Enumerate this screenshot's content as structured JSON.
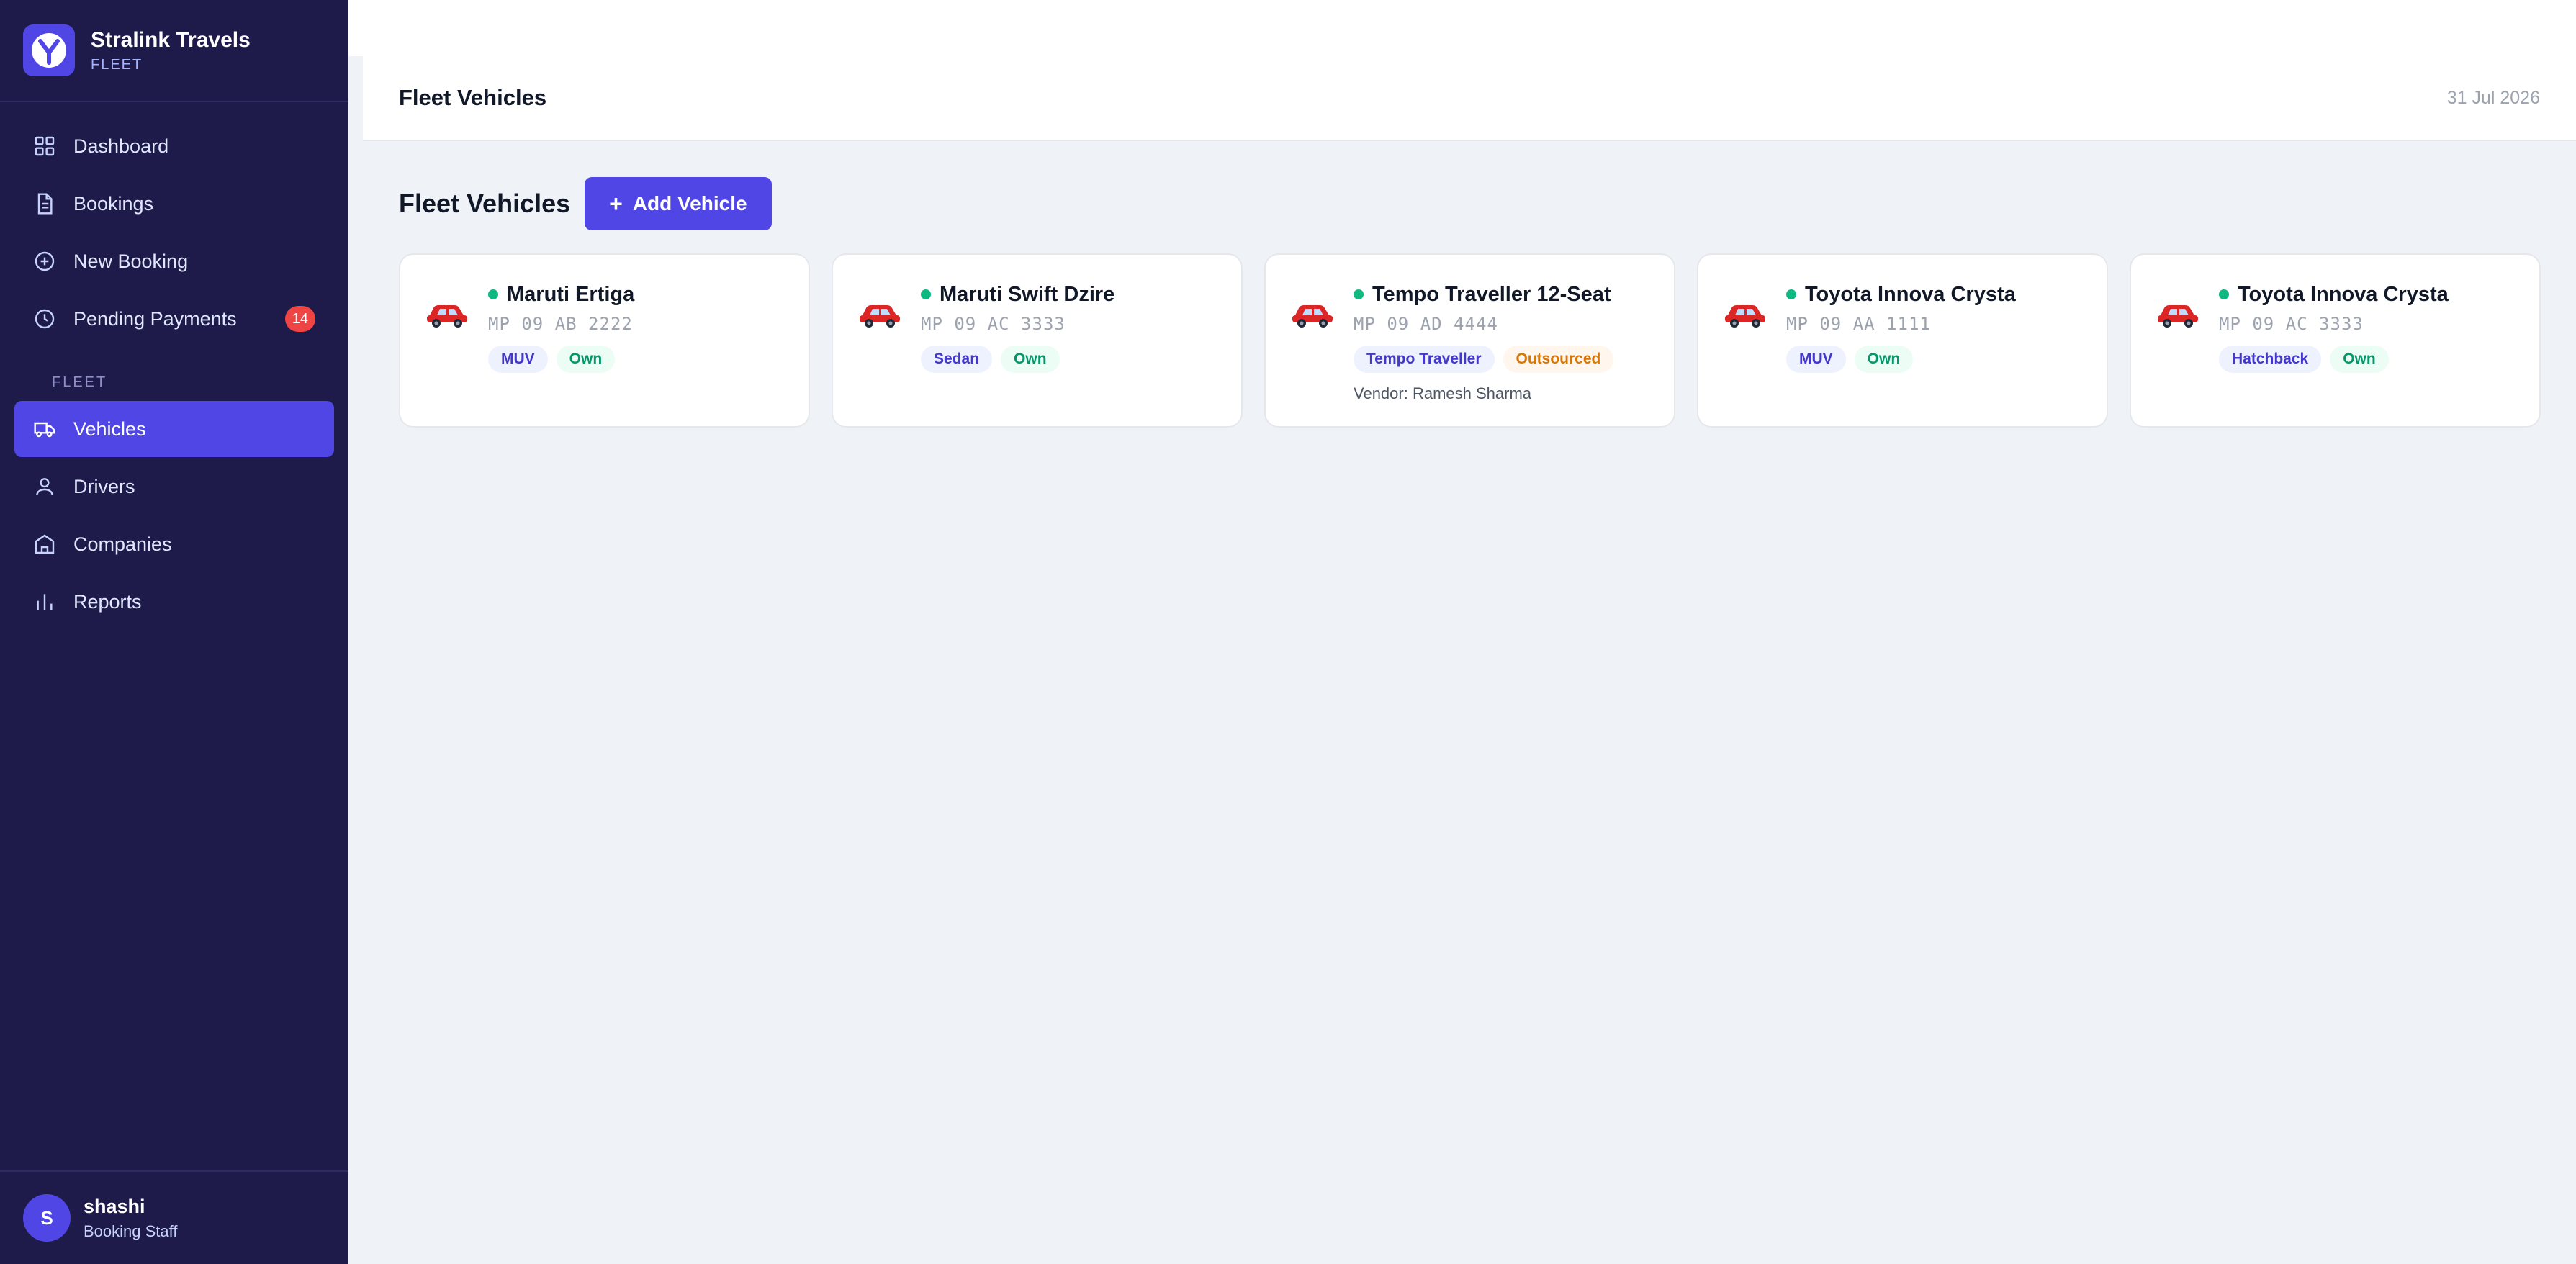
{
  "brand": {
    "name": "Stralink Travels",
    "subtitle": "FLEET",
    "logo_icon": "y-logo-icon"
  },
  "sidebar": {
    "items": [
      {
        "label": "Dashboard",
        "icon": "grid-icon"
      },
      {
        "label": "Bookings",
        "icon": "document-icon"
      },
      {
        "label": "New Booking",
        "icon": "plus-circle-icon"
      },
      {
        "label": "Pending Payments",
        "icon": "clock-icon",
        "badge": "14"
      }
    ],
    "section_label": "FLEET",
    "fleet_items": [
      {
        "label": "Vehicles",
        "icon": "truck-icon",
        "active": true
      },
      {
        "label": "Drivers",
        "icon": "user-icon"
      },
      {
        "label": "Companies",
        "icon": "building-icon"
      },
      {
        "label": "Reports",
        "icon": "bar-chart-icon"
      }
    ]
  },
  "user": {
    "initial": "S",
    "name": "shashi",
    "role": "Booking Staff"
  },
  "header": {
    "title": "Fleet Vehicles",
    "date": "31 Jul 2026"
  },
  "page": {
    "title": "Fleet Vehicles",
    "add_button": "Add Vehicle"
  },
  "vehicles": [
    {
      "name": "Maruti Ertiga",
      "plate": "MP 09 AB 2222",
      "type": "MUV",
      "ownership": "Own",
      "vendor": ""
    },
    {
      "name": "Maruti Swift Dzire",
      "plate": "MP 09 AC 3333",
      "type": "Sedan",
      "ownership": "Own",
      "vendor": ""
    },
    {
      "name": "Tempo Traveller 12-Seat",
      "plate": "MP 09 AD 4444",
      "type": "Tempo Traveller",
      "ownership": "Outsourced",
      "vendor": "Vendor: Ramesh Sharma"
    },
    {
      "name": "Toyota Innova Crysta",
      "plate": "MP 09 AA 1111",
      "type": "MUV",
      "ownership": "Own",
      "vendor": ""
    },
    {
      "name": "Toyota Innova Crysta",
      "plate": "MP 09 AC 3333",
      "type": "Hatchback",
      "ownership": "Own",
      "vendor": ""
    }
  ],
  "colors": {
    "sidebar_bg": "#1e1b4b",
    "accent": "#4f46e5",
    "badge": "#ef4444",
    "status_active": "#10b981"
  }
}
